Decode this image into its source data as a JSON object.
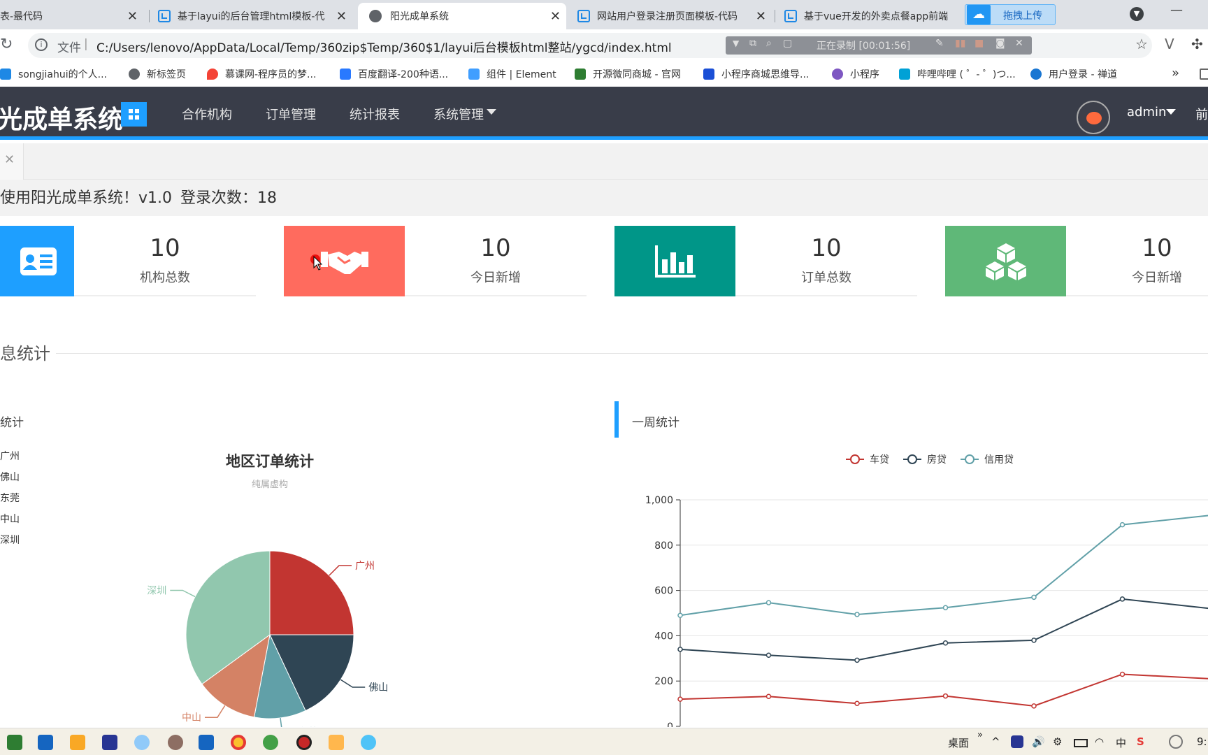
{
  "browser": {
    "tabs": [
      {
        "title": "表-最代码"
      },
      {
        "title": "基于layui的后台管理html模板-代"
      },
      {
        "title": "阳光成单系统"
      },
      {
        "title": "网站用户登录注册页面模板-代码"
      },
      {
        "title": "基于vue开发的外卖点餐app前端"
      }
    ],
    "upload_button": "拖拽上传",
    "address": {
      "scheme_label": "文件",
      "url": "C:/Users/lenovo/AppData/Local/Temp/360zip$Temp/360$1/layui后台模板html整站/ygcd/index.html"
    },
    "recording": {
      "text": "正在录制 [00:01:56]"
    },
    "bookmarks": [
      {
        "label": "songjiahui的个人...",
        "icon": "csdn-icon",
        "color": "#1e88e5"
      },
      {
        "label": "新标签页",
        "icon": "globe-icon",
        "color": "#5f6368"
      },
      {
        "label": "慕课网-程序员的梦...",
        "icon": "flame-icon",
        "color": "#f44336"
      },
      {
        "label": "百度翻译-200种语...",
        "icon": "translate-icon",
        "color": "#2979ff"
      },
      {
        "label": "组件 | Element",
        "icon": "element-icon",
        "color": "#409eff"
      },
      {
        "label": "开源微同商城 - 官网",
        "icon": "vue-icon",
        "color": "#2e7d32"
      },
      {
        "label": "小程序商城思维导...",
        "icon": "on-icon",
        "color": "#1a4fd6"
      },
      {
        "label": "小程序",
        "icon": "link-icon",
        "color": "#7e57c2"
      },
      {
        "label": "哔哩哔哩 ( ゜- ゜)つ...",
        "icon": "bilibili-icon",
        "color": "#00a1d6"
      },
      {
        "label": "用户登录 - 禅道",
        "icon": "zentao-icon",
        "color": "#1976d2"
      }
    ],
    "more_bookmarks": "»"
  },
  "app": {
    "title": "光成单系统",
    "nav": [
      "合作机构",
      "订单管理",
      "统计报表",
      "系统管理"
    ],
    "user": "admin",
    "right_cut": "前"
  },
  "welcome": {
    "text": "使用阳光成单系统！v1.0",
    "login_label": "登录次数：18"
  },
  "stats": [
    {
      "value": "10",
      "label": "机构总数",
      "color": "#1e9fff",
      "icon": "id-card-icon"
    },
    {
      "value": "10",
      "label": "今日新增",
      "color": "#ff6b5e",
      "icon": "handshake-icon"
    },
    {
      "value": "10",
      "label": "订单总数",
      "color": "#009688",
      "icon": "bar-chart-icon"
    },
    {
      "value": "10",
      "label": "今日新增",
      "color": "#5fb878",
      "icon": "cubes-icon"
    }
  ],
  "section_title": "息统计",
  "left_panel": {
    "title": "统计"
  },
  "right_panel": {
    "title": "一周统计"
  },
  "chart_data": [
    {
      "type": "pie",
      "title": "地区订单统计",
      "subtitle": "纯属虚构",
      "legend": [
        "广州",
        "佛山",
        "东莞",
        "中山",
        "深圳"
      ],
      "categories": [
        "广州",
        "佛山",
        "东莞",
        "中山",
        "深圳"
      ],
      "values": [
        25,
        18,
        10,
        12,
        35
      ],
      "colors": [
        "#c23531",
        "#2f4554",
        "#61a0a8",
        "#d48265",
        "#91c7ae"
      ]
    },
    {
      "type": "line",
      "legend": [
        "车贷",
        "房贷",
        "信用贷"
      ],
      "ylim": [
        0,
        1000
      ],
      "yticks": [
        "0",
        "200",
        "400",
        "600",
        "800",
        "1,000"
      ],
      "x_points": 7,
      "series": [
        {
          "name": "车贷",
          "color": "#c23531",
          "values": [
            120,
            132,
            101,
            134,
            90,
            230,
            210
          ]
        },
        {
          "name": "房贷",
          "color": "#2f4554",
          "values": [
            340,
            314,
            292,
            368,
            380,
            562,
            520
          ]
        },
        {
          "name": "信用贷",
          "color": "#61a0a8",
          "values": [
            490,
            546,
            494,
            524,
            570,
            890,
            932
          ]
        }
      ]
    }
  ],
  "taskbar": {
    "desktop_label": "桌面",
    "ime": "中",
    "clock": "9:"
  }
}
